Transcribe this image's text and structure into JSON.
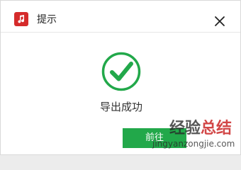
{
  "window": {
    "title": "提示",
    "app_icon": "music-note-icon",
    "close_icon": "close-icon"
  },
  "body": {
    "status_icon": "check-circle-icon",
    "message": "导出成功"
  },
  "footer": {
    "button_label": "前往"
  },
  "watermark": {
    "brand_part1": "经验",
    "brand_part2": "总结",
    "url": "jingyanzongjie.com"
  },
  "colors": {
    "app_icon_bg": "#d52b2b",
    "success_green": "#22a84a",
    "watermark_accent": "#c81e1e"
  }
}
